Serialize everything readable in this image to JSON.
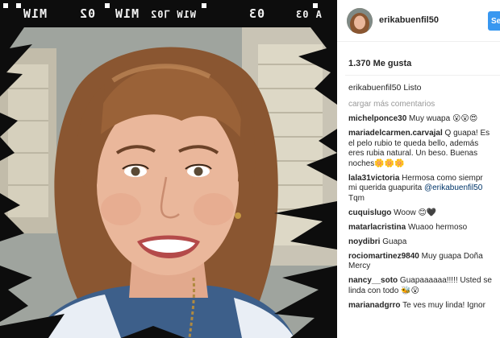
{
  "post": {
    "owner": "erikabuenfil50",
    "follow_label": "Segu",
    "likes": "1.370 Me gusta"
  },
  "film_labels": [
    "M1W",
    "02",
    "M1W",
    "W1W ⅂02",
    "03",
    "A 03"
  ],
  "caption": {
    "user": "erikabuenfil50",
    "text": "Listo"
  },
  "load_more": "cargar más comentarios",
  "comments": [
    {
      "user": "michelponce30",
      "lines": [
        "Muy wuapa 😮😮😍"
      ]
    },
    {
      "user": "mariadelcarmen.carvajal",
      "lines": [
        "Q guapa! Es",
        "el pelo rubio te queda bello, además",
        "eres rubia natural. Un beso. Buenas",
        "noches🌼🌼🌼"
      ]
    },
    {
      "user": "lala31victoria",
      "lines": [
        "Hermosa como siempr",
        "mi querida guapurita"
      ],
      "mention": "@erikabuenfil50",
      "tail": "Tqm"
    },
    {
      "user": "cuquislugo",
      "lines": [
        "Woow 😊🖤"
      ]
    },
    {
      "user": "matarlacristina",
      "lines": [
        "Wuaoo hermoso"
      ]
    },
    {
      "user": "noydibri",
      "lines": [
        "Guapa"
      ]
    },
    {
      "user": "rociomartinez9840",
      "lines": [
        "Muy guapa Doña",
        "Mercy"
      ]
    },
    {
      "user": "nancy__soto",
      "lines": [
        "Guapaaaaaa!!!!! Usted se",
        "linda con todo 🐝😮"
      ]
    },
    {
      "user": "marianadgrro",
      "lines": [
        "Te ves muy linda! Ignor"
      ]
    }
  ]
}
